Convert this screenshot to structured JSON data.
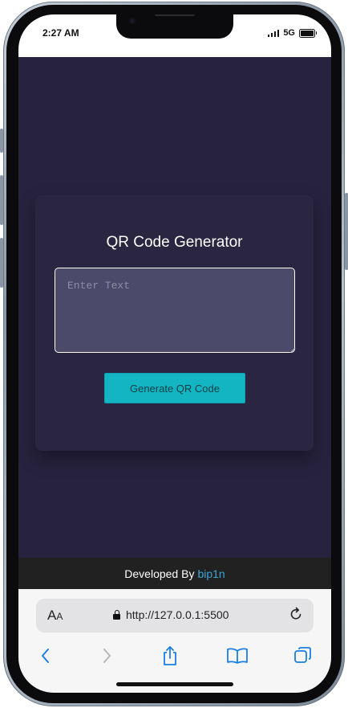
{
  "status": {
    "time": "2:27 AM",
    "network": "5G"
  },
  "app": {
    "title": "QR Code Generator",
    "input_placeholder": "Enter Text",
    "button_label": "Generate QR Code",
    "accent_color": "#13b5c3",
    "background_color": "#27233f"
  },
  "footer": {
    "prefix": "Developed By",
    "author": "bip1n",
    "author_color": "#3aa6d8"
  },
  "browser": {
    "text_size_label": "AA",
    "url": "http://127.0.0.1:5500",
    "icons": [
      "back-icon",
      "forward-icon",
      "share-icon",
      "bookmarks-icon",
      "tabs-icon",
      "reload-icon",
      "lock-icon"
    ]
  }
}
